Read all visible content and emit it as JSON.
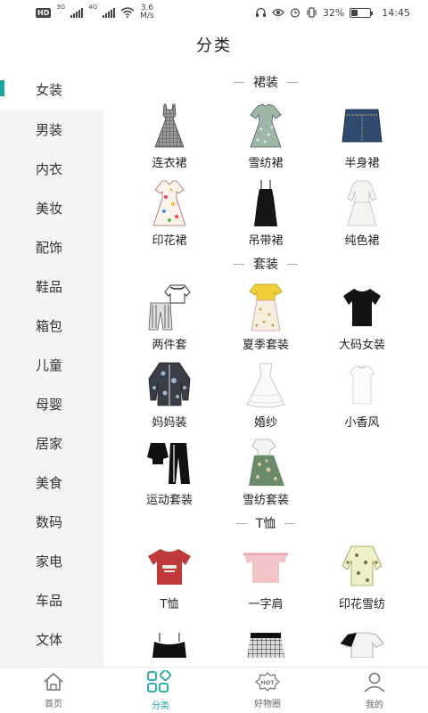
{
  "status_bar": {
    "hd": "HD",
    "net1": "3G",
    "net2": "4G",
    "speed_value": "3.6",
    "speed_unit": "M/s",
    "battery_text": "32%",
    "battery_level": 0.32,
    "time": "14:45"
  },
  "header": {
    "title": "分类"
  },
  "sidebar": {
    "items": [
      {
        "label": "女装",
        "active": true
      },
      {
        "label": "男装"
      },
      {
        "label": "内衣"
      },
      {
        "label": "美妆"
      },
      {
        "label": "配饰"
      },
      {
        "label": "鞋品"
      },
      {
        "label": "箱包"
      },
      {
        "label": "儿童"
      },
      {
        "label": "母婴"
      },
      {
        "label": "居家"
      },
      {
        "label": "美食"
      },
      {
        "label": "数码"
      },
      {
        "label": "家电"
      },
      {
        "label": "车品"
      },
      {
        "label": "文体"
      }
    ]
  },
  "sections": [
    {
      "title": "裙装",
      "items": [
        {
          "label": "连衣裙",
          "icon": "plaid-dress-icon"
        },
        {
          "label": "雪纺裙",
          "icon": "chiffon-dress-icon"
        },
        {
          "label": "半身裙",
          "icon": "denim-skirt-icon"
        },
        {
          "label": "印花裙",
          "icon": "print-dress-icon"
        },
        {
          "label": "吊带裙",
          "icon": "slip-dress-icon"
        },
        {
          "label": "纯色裙",
          "icon": "white-dress-icon"
        }
      ]
    },
    {
      "title": "套装",
      "items": [
        {
          "label": "两件套",
          "icon": "two-piece-icon"
        },
        {
          "label": "夏季套装",
          "icon": "summer-set-icon"
        },
        {
          "label": "大码女装",
          "icon": "black-tee-icon"
        },
        {
          "label": "妈妈装",
          "icon": "floral-jacket-icon"
        },
        {
          "label": "婚纱",
          "icon": "wedding-dress-icon"
        },
        {
          "label": "小香风",
          "icon": "white-top-icon"
        },
        {
          "label": "运动套装",
          "icon": "sport-set-icon"
        },
        {
          "label": "雪纺套装",
          "icon": "chiffon-set-icon"
        }
      ]
    },
    {
      "title": "T恤",
      "items": [
        {
          "label": "T恤",
          "icon": "red-tshirt-icon"
        },
        {
          "label": "一字肩",
          "icon": "off-shoulder-top-icon"
        },
        {
          "label": "印花雪纺",
          "icon": "print-chiffon-top-icon"
        },
        {
          "label": "",
          "icon": "black-camisole-icon"
        },
        {
          "label": "",
          "icon": "plaid-top-icon"
        },
        {
          "label": "",
          "icon": "black-white-tee-icon"
        }
      ]
    }
  ],
  "bottom_nav": [
    {
      "label": "首页",
      "icon": "home-icon"
    },
    {
      "label": "分类",
      "icon": "category-icon",
      "active": true
    },
    {
      "label": "好物圈",
      "icon": "hot-badge-icon",
      "badge": "HOT"
    },
    {
      "label": "我的",
      "icon": "user-icon"
    }
  ],
  "colors": {
    "accent": "#1aa6a0",
    "sidebar_bg": "#f4f4f4",
    "divider": "#e3e3e3"
  }
}
